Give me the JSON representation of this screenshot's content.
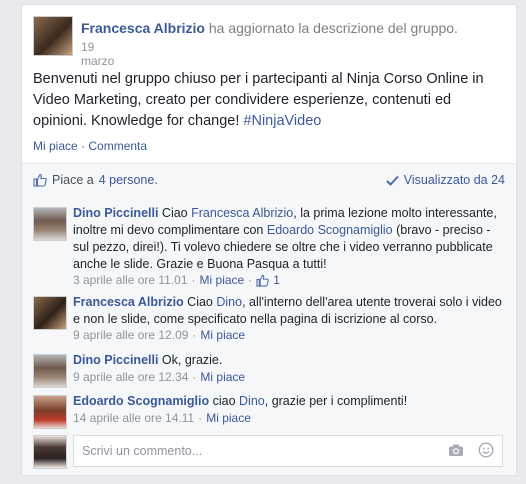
{
  "post": {
    "author": "Francesca Albrizio",
    "action": "ha aggiornato la descrizione del gruppo.",
    "date": "19 marzo",
    "body": "Benvenuti nel gruppo chiuso per i partecipanti al Ninja Corso Online in Video Marketing, creato per condividere esperienze, contenuti ed opinioni. Knowledge for change!",
    "hashtag": "#NinjaVideo",
    "like_label": "Mi piace",
    "comment_label": "Commenta",
    "separator": "·"
  },
  "likes_bar": {
    "prefix": "Piace a",
    "count_link": "4 persone",
    "suffix": ".",
    "seen_label": "Visualizzato da 24"
  },
  "comments": [
    {
      "author": "Dino Piccinelli",
      "t1": "Ciao",
      "mention1": "Francesca Albrizio",
      "t2": ", la prima lezione molto interessante, inoltre mi devo complimentare con",
      "mention2": "Edoardo Scognamiglio",
      "t3": "(bravo - preciso - sul pezzo, direi!). Ti volevo chiedere se oltre che i video verranno pubblicate anche le slide. Grazie e Buona Pasqua a tutti!",
      "time": "3 aprile alle ore 11.01",
      "like": "Mi piace",
      "likes": "1"
    },
    {
      "author": "Francesca Albrizio",
      "t1": "Ciao",
      "mention1": "Dino",
      "t2": ", all'interno dell'area utente troverai solo i video e non le slide, come specificato nella pagina di iscrizione al corso.",
      "time": "9 aprile alle ore 12.09",
      "like": "Mi piace"
    },
    {
      "author": "Dino Piccinelli",
      "t1": "Ok, grazie.",
      "time": "9 aprile alle ore 12.34",
      "like": "Mi piace"
    },
    {
      "author": "Edoardo Scognamiglio",
      "t1": "ciao",
      "mention1": "Dino",
      "t2": ", grazie per i complimenti!",
      "time": "14 aprile alle ore 14.11",
      "like": "Mi piace"
    }
  ],
  "composer": {
    "placeholder": "Scrivi un commento..."
  },
  "icons": {
    "like": "thumbs-up-icon",
    "seen": "checkmark-icon",
    "camera": "camera-icon",
    "emoji": "smiley-icon"
  },
  "colors": {
    "link": "#3b5998",
    "text": "#1d2129",
    "muted": "#90949c",
    "background": "#e9eaed",
    "panel": "#f6f7f9"
  }
}
